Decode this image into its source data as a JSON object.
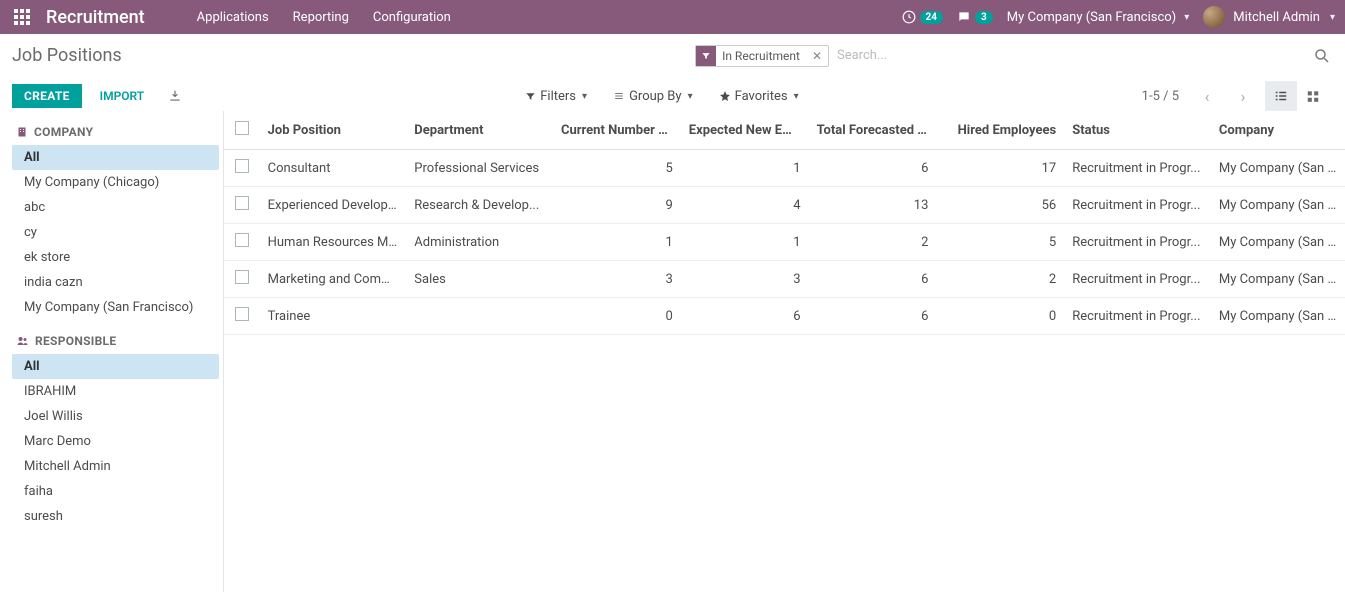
{
  "topnav": {
    "brand": "Recruitment",
    "menu": [
      "Applications",
      "Reporting",
      "Configuration"
    ],
    "activity_count": "24",
    "message_count": "3",
    "company": "My Company (San Francisco)",
    "user": "Mitchell Admin"
  },
  "page": {
    "title": "Job Positions",
    "create_label": "CREATE",
    "import_label": "IMPORT",
    "search": {
      "facet_label": "In Recruitment",
      "placeholder": "Search..."
    },
    "filters_label": "Filters",
    "groupby_label": "Group By",
    "favorites_label": "Favorites",
    "pager": "1-5 / 5"
  },
  "sidebar": {
    "company_header": "COMPANY",
    "company_items": [
      "All",
      "My Company (Chicago)",
      "abc",
      "cy",
      "ek store",
      "india cazn",
      "My Company (San Francisco)"
    ],
    "company_selected": 0,
    "responsible_header": "RESPONSIBLE",
    "responsible_items": [
      "All",
      "IBRAHIM",
      "Joel Willis",
      "Marc Demo",
      "Mitchell Admin",
      "faiha",
      "suresh"
    ],
    "responsible_selected": 0
  },
  "table": {
    "headers": [
      "Job Position",
      "Department",
      "Current Number of ...",
      "Expected New Emp...",
      "Total Forecasted E...",
      "Hired Employees",
      "Status",
      "Company"
    ],
    "rows": [
      {
        "job": "Consultant",
        "dept": "Professional Services",
        "current": "5",
        "expected": "1",
        "forecast": "6",
        "hired": "17",
        "status": "Recruitment in Progr...",
        "company": "My Company (San ..."
      },
      {
        "job": "Experienced Developer",
        "dept": "Research & Develop...",
        "current": "9",
        "expected": "4",
        "forecast": "13",
        "hired": "56",
        "status": "Recruitment in Progr...",
        "company": "My Company (San ..."
      },
      {
        "job": "Human Resources M...",
        "dept": "Administration",
        "current": "1",
        "expected": "1",
        "forecast": "2",
        "hired": "5",
        "status": "Recruitment in Progr...",
        "company": "My Company (San ..."
      },
      {
        "job": "Marketing and Comm...",
        "dept": "Sales",
        "current": "3",
        "expected": "3",
        "forecast": "6",
        "hired": "2",
        "status": "Recruitment in Progr...",
        "company": "My Company (San ..."
      },
      {
        "job": "Trainee",
        "dept": "",
        "current": "0",
        "expected": "6",
        "forecast": "6",
        "hired": "0",
        "status": "Recruitment in Progr...",
        "company": "My Company (San ..."
      }
    ]
  }
}
